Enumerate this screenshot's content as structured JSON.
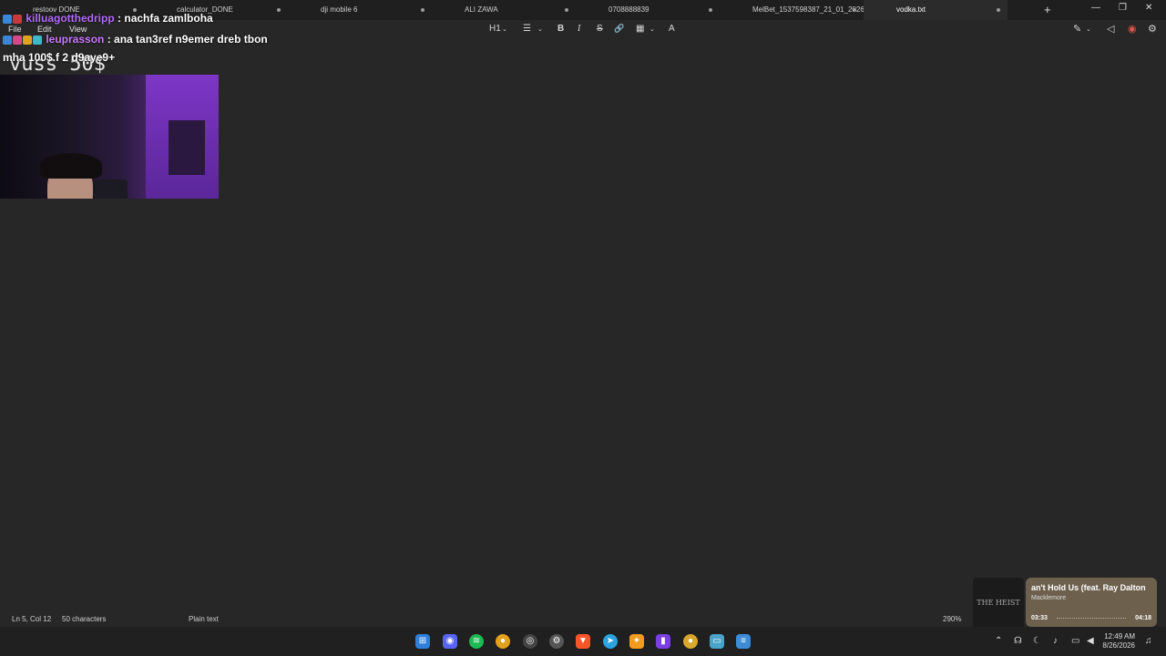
{
  "tabs": [
    {
      "label": "restoov DONE",
      "active": false
    },
    {
      "label": "calculator_DONE",
      "active": false
    },
    {
      "label": "dji mobile 6",
      "active": false
    },
    {
      "label": "ALI ZAWA",
      "active": false
    },
    {
      "label": "0708888839",
      "active": false
    },
    {
      "label": "MelBet_1537598387_21_01_2026.txt",
      "active": false
    },
    {
      "label": "vodka.txt",
      "active": true
    }
  ],
  "menu": {
    "file": "File",
    "edit": "Edit",
    "view": "View"
  },
  "toolbar": {
    "heading": "H1",
    "list": "☰",
    "bold": "B",
    "italic": "I",
    "strike": "S",
    "link": "🔗",
    "table": "▦",
    "clear_format": "A"
  },
  "chat": [
    {
      "user": "killuagotthedripp",
      "message": ": nachfa zamlboha"
    },
    {
      "user": "leuprasson",
      "message": ": ana tan3ref n9emer dreb tbon"
    },
    {
      "user": "",
      "message": "mha 100$ f 2 d9aye9+"
    }
  ],
  "editor": {
    "content": "vuss 50$"
  },
  "statusbar": {
    "position": "Ln 5, Col 12",
    "characters": "50 characters",
    "format": "Plain text",
    "zoom": "290%"
  },
  "media": {
    "title": "an't Hold Us (feat. Ray Dalton",
    "artist": "Macklemore",
    "elapsed": "03:33",
    "duration": "04:18",
    "art_text": "THE HEIST",
    "progress_fraction": 0.83
  },
  "clock": {
    "time": "12:49 AM",
    "date": "8/26/2026"
  },
  "colors": {
    "accent": "#b46cff",
    "background": "#272727",
    "taskbar": "#202020"
  }
}
